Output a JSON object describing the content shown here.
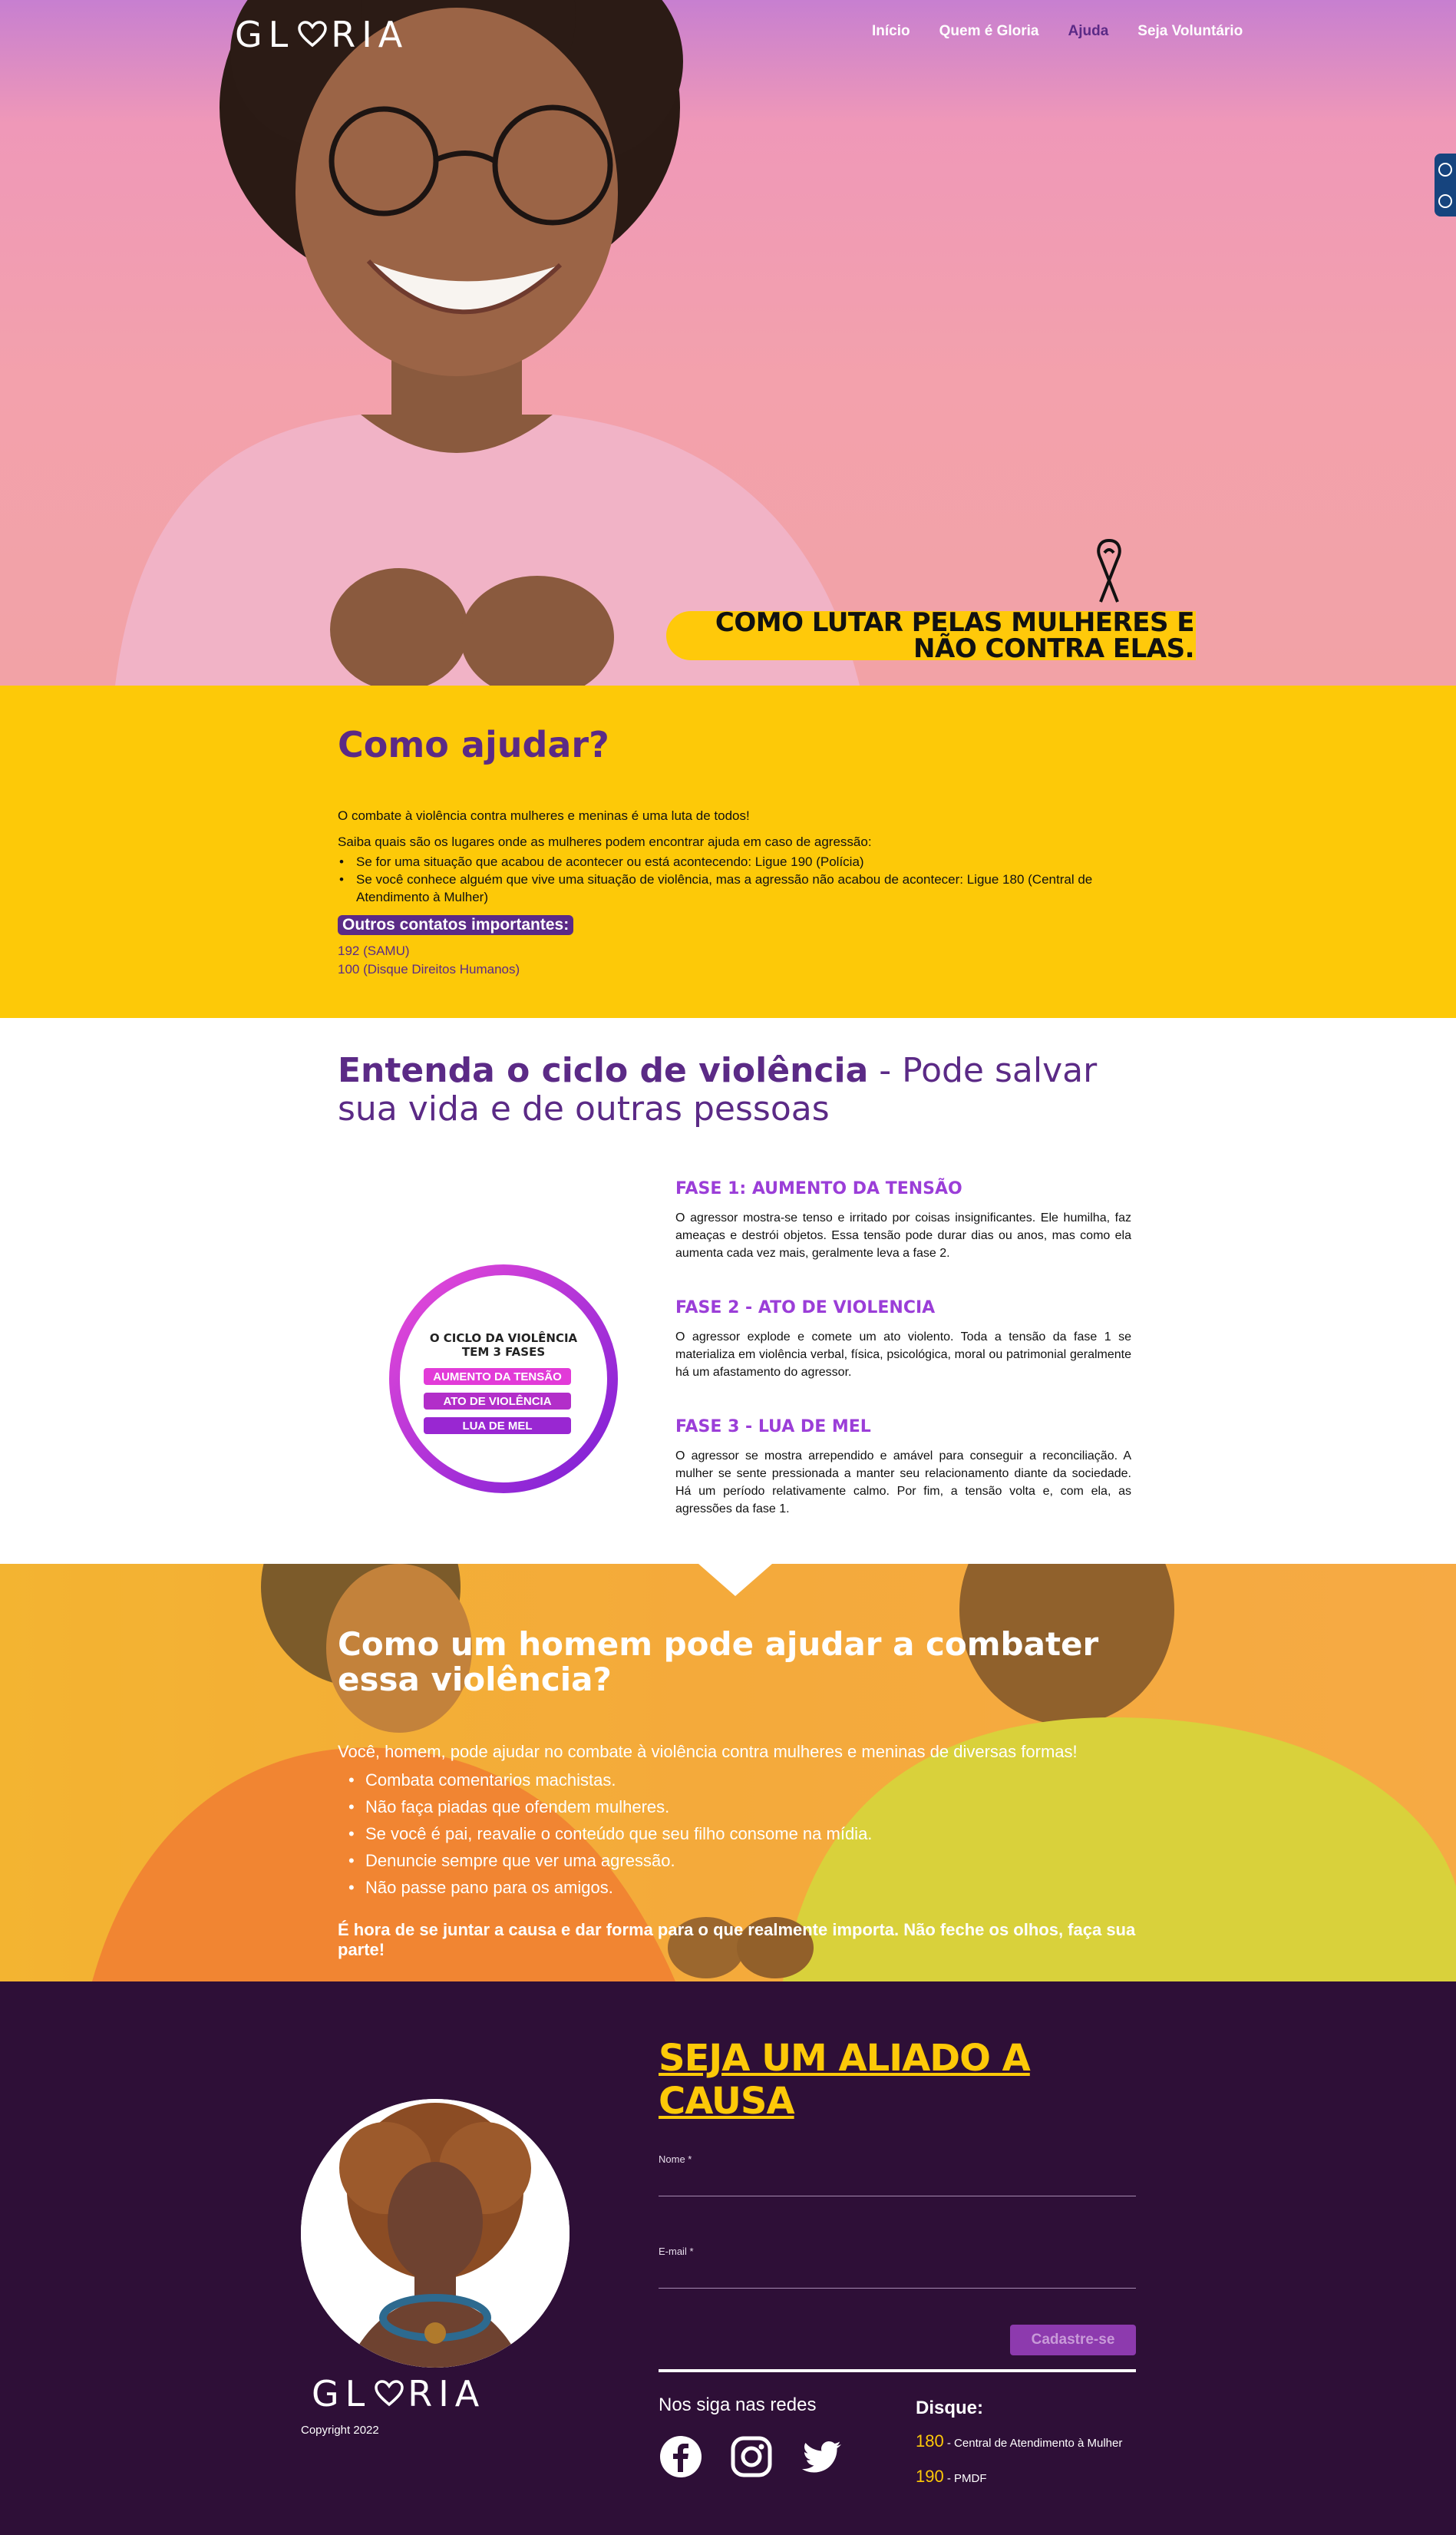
{
  "brand": {
    "logo_left": "GL",
    "logo_right": "RIA"
  },
  "nav": [
    {
      "label": "Início",
      "active": false
    },
    {
      "label": "Quem é Gloria",
      "active": false
    },
    {
      "label": "Ajuda",
      "active": true
    },
    {
      "label": "Seja Voluntário",
      "active": false
    }
  ],
  "hero": {
    "tagline_line1": "COMO LUTAR PELAS MULHERES E",
    "tagline_line2": "NÃO CONTRA ELAS."
  },
  "help": {
    "title": "Como ajudar?",
    "p1": "O combate à violência contra mulheres e meninas é uma luta de todos!",
    "p2": "Saiba quais são os lugares onde as mulheres podem encontrar ajuda em caso de agressão:",
    "bullets": [
      "Se for uma situação que acabou de acontecer ou está acontecendo: Ligue 190 (Polícia)",
      "Se você conhece alguém que vive uma situação de violência, mas a agressão não acabou de acontecer: Ligue 180 (Central de Atendimento à Mulher)"
    ],
    "badge": "Outros contatos importantes:",
    "contacts": [
      "192 (SAMU)",
      "100 (Disque Direitos Humanos)"
    ]
  },
  "cycle": {
    "title_bold": "Entenda o ciclo de violência",
    "title_rest": " - Pode salvar sua vida e de outras pessoas",
    "graphic": {
      "heading_line1": "O CICLO DA VIOLÊNCIA",
      "heading_line2": "TEM 3 FASES",
      "pills": [
        "AUMENTO DA TENSÃO",
        "ATO DE VIOLÊNCIA",
        "LUA DE MEL"
      ]
    },
    "phases": [
      {
        "title": "FASE 1: AUMENTO DA TENSÃO",
        "text": "O agressor mostra-se tenso e irritado por coisas insignificantes. Ele humilha, faz ameaças e destrói objetos. Essa tensão pode durar dias ou anos, mas como ela aumenta cada vez mais, geralmente leva a fase 2."
      },
      {
        "title": "FASE 2 - ATO DE VIOLENCIA",
        "text": "O agressor explode e comete um ato violento. Toda a tensão da fase 1 se materializa em violência verbal, física, psicológica, moral ou patrimonial geralmente há um afastamento do agressor."
      },
      {
        "title": "FASE 3 - LUA DE MEL",
        "text": "O agressor se mostra arrependido e amável para conseguir a reconciliação. A mulher se sente pressionada a manter seu relacionamento diante da sociedade. Há um período relativamente calmo. Por fim, a tensão volta e, com ela, as agressões da fase 1."
      }
    ]
  },
  "men": {
    "title": "Como um homem pode ajudar a combater essa violência?",
    "intro": "Você, homem, pode ajudar no combate à violência contra mulheres e meninas de diversas formas!",
    "bullets": [
      "Combata comentarios machistas.",
      "Não faça piadas que ofendem mulheres.",
      "Se você é pai, reavalie o conteúdo que seu filho consome na mídia.",
      "Denuncie sempre que ver uma agressão.",
      "Não passe pano para os amigos."
    ],
    "cta": "É hora de se juntar a causa e dar forma para o que realmente importa. Não feche os olhos, faça sua parte!"
  },
  "footer": {
    "ally_title": "SEJA UM ALIADO A CAUSA",
    "name_label": "Nome *",
    "email_label": "E-mail *",
    "name_value": "",
    "email_value": "",
    "submit_label": "Cadastre-se",
    "follow_label": "Nos siga nas redes",
    "socials": [
      "facebook-icon",
      "instagram-icon",
      "twitter-icon"
    ],
    "disque_title": "Disque:",
    "phones": [
      {
        "number": "180",
        "desc": " - Central de Atendimento à Mulher"
      },
      {
        "number": "190",
        "desc": " - PMDF"
      }
    ],
    "copyright": "Copyright 2022"
  },
  "colors": {
    "purple": "#5b2a86",
    "yellow": "#fdc908",
    "footer_bg": "#2e0f37",
    "phase_title": "#9b3ed8"
  }
}
